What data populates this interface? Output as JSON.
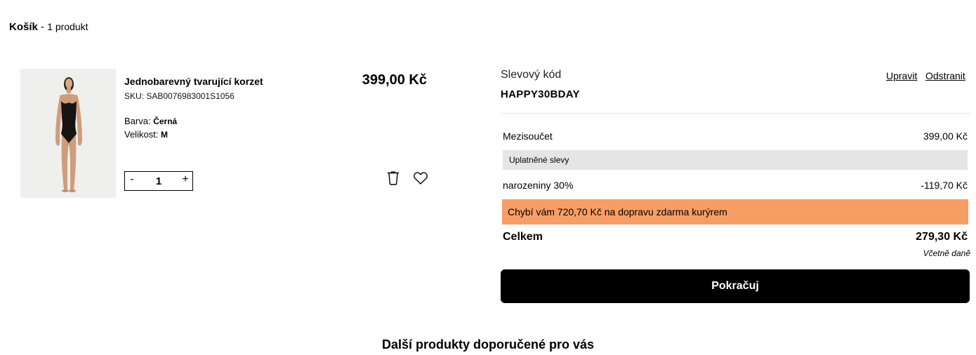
{
  "cart": {
    "title": "Košík",
    "separator": " - ",
    "count_label": "1 produkt"
  },
  "product": {
    "name": "Jednobarevný tvarující korzet",
    "sku": "SKU: SAB0076983001S1056",
    "color_label": "Barva:",
    "color_value": "Černá",
    "size_label": "Velikost:",
    "size_value": "M",
    "price": "399,00 Kč",
    "quantity": {
      "minus": "-",
      "value": "1",
      "plus": "+"
    },
    "image_icon": "model-photo"
  },
  "summary": {
    "discount_label": "Slevový kód",
    "discount_code": "HAPPY30BDAY",
    "edit_link": "Upravit",
    "remove_link": "Odstranit",
    "subtotal_label": "Mezisoučet",
    "subtotal_value": "399,00 Kč",
    "applied_discounts_label": "Uplatněné slevy",
    "promo_label": "narozeniny 30%",
    "promo_value": "-119,70 Kč",
    "shipping_notice": "Chybí vám 720,70 Kč na dopravu zdarma kurýrem",
    "total_label": "Celkem",
    "total_value": "279,30 Kč",
    "tax_note": "Včetně daně",
    "continue_button": "Pokračuj"
  },
  "recommendations": {
    "title": "Další produkty doporučené pro vás"
  },
  "colors": {
    "shipping_bar": "#f79d66",
    "applied_bar": "#e5e5e5",
    "button_bg": "#000000",
    "button_text": "#ffffff"
  },
  "icons": {
    "trash": "trash-icon",
    "wishlist": "heart-icon"
  }
}
